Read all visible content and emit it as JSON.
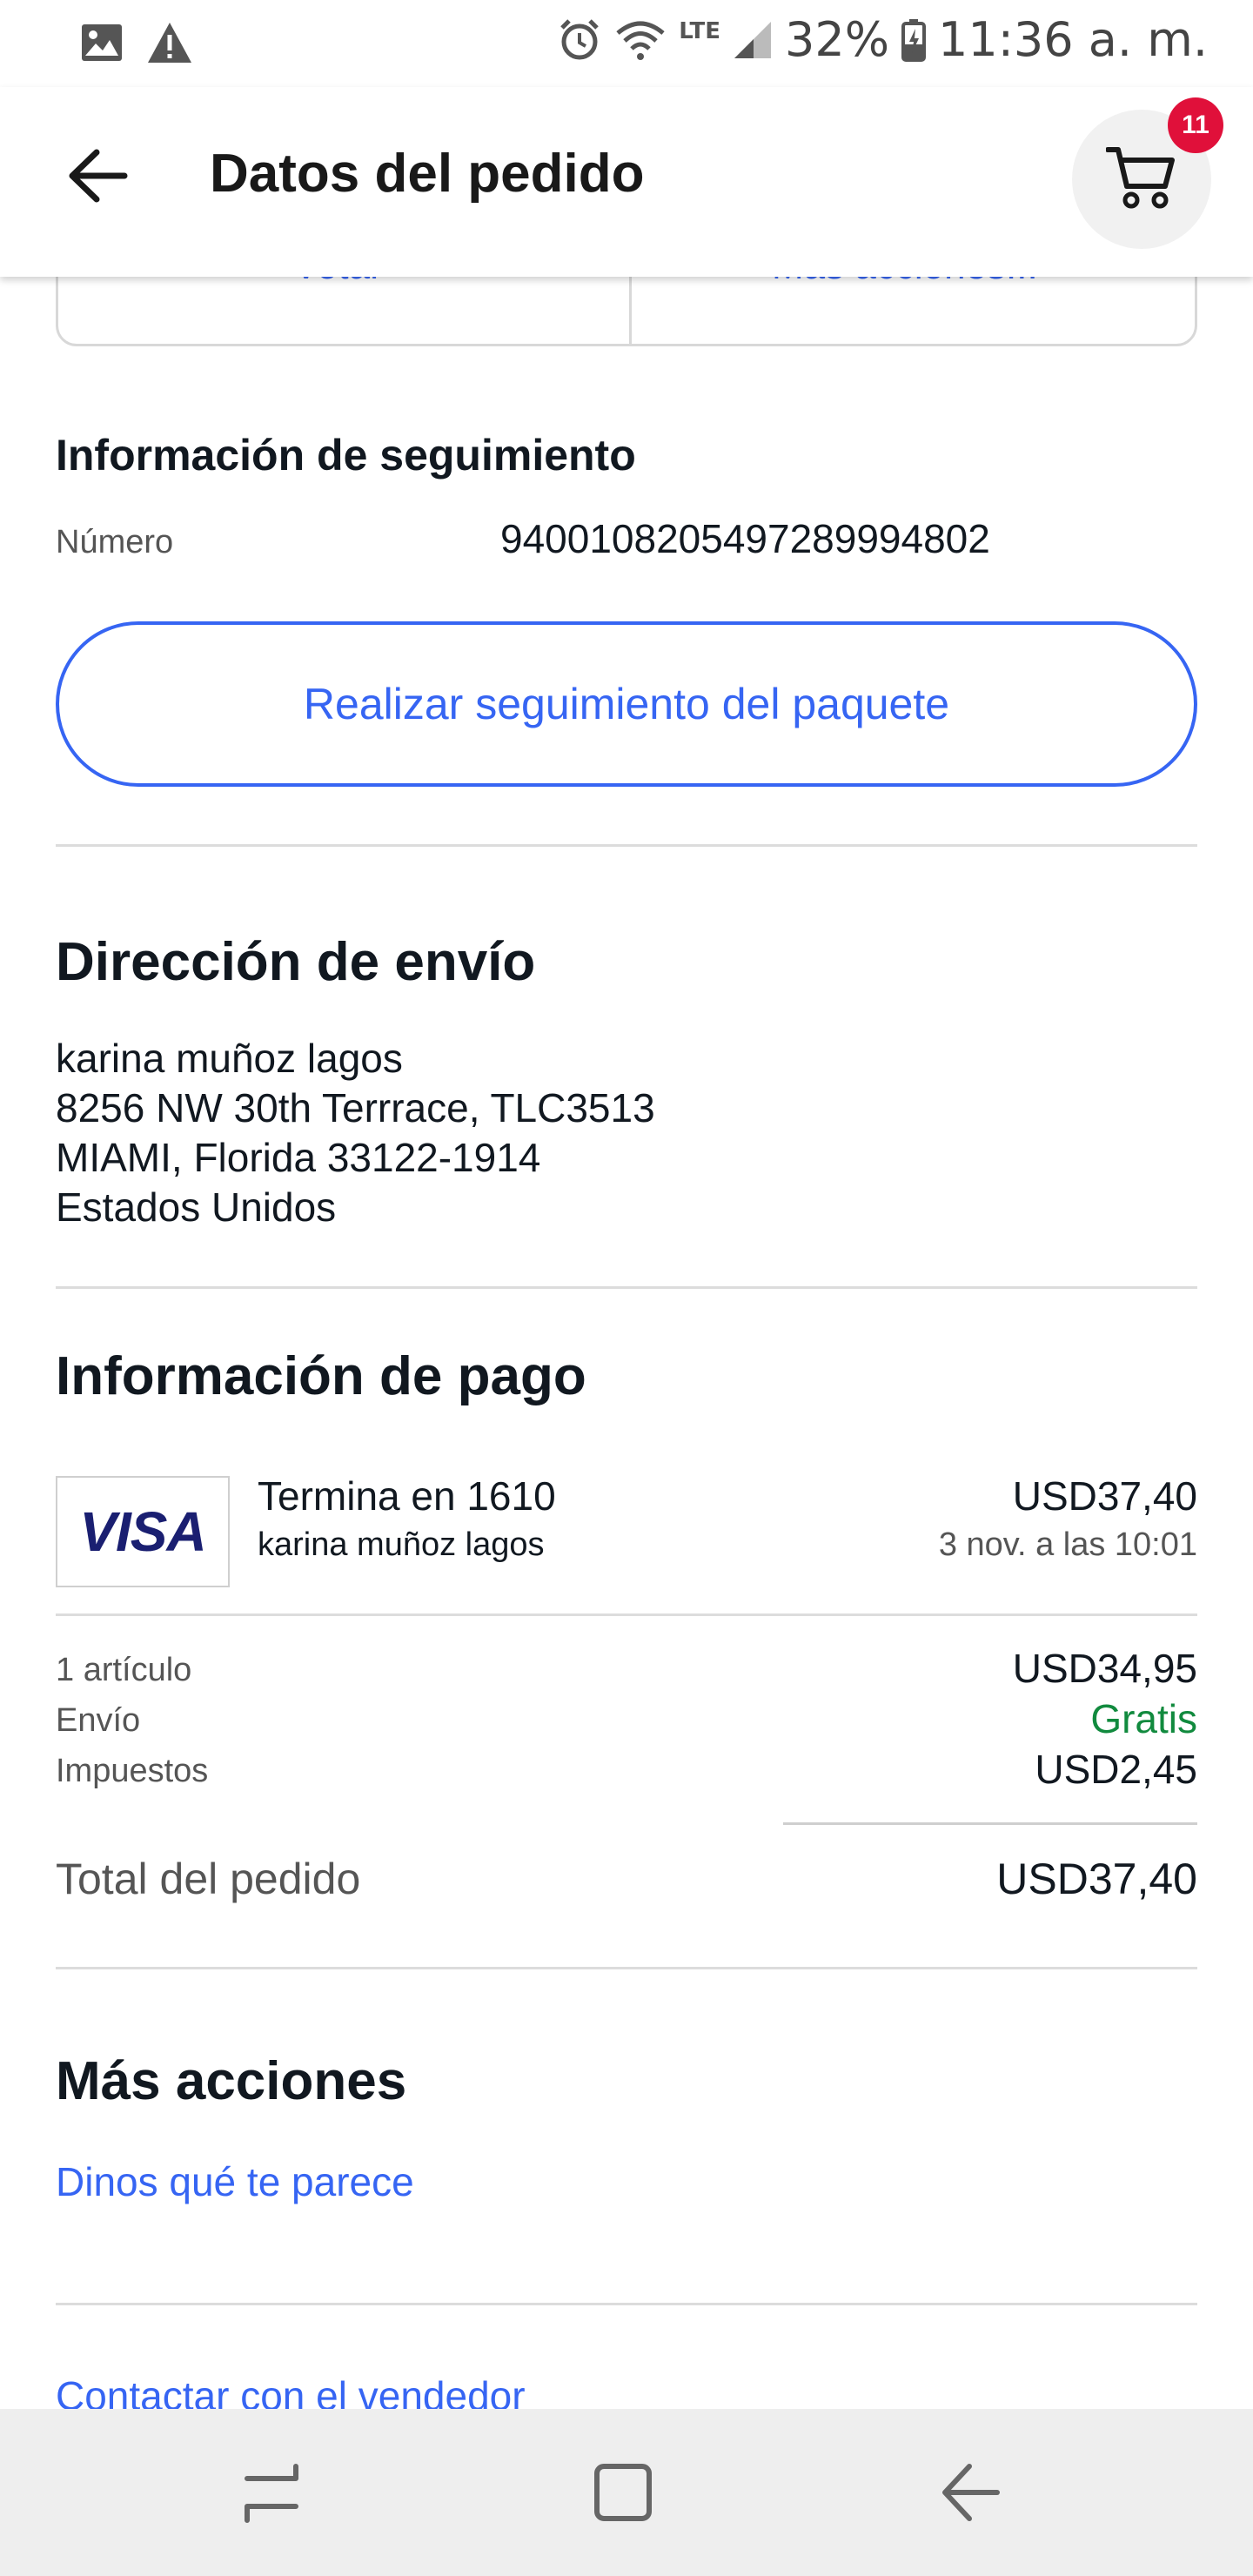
{
  "status_bar": {
    "left_icons": [
      "image-icon",
      "warning-icon"
    ],
    "network": "LTE",
    "battery": "32%",
    "time": "11:36 a. m."
  },
  "app_bar": {
    "title": "Datos del pedido",
    "cart_badge": "11"
  },
  "previous_card": {
    "left_button": "Votar",
    "right_button": "Más acciones..."
  },
  "tracking": {
    "title": "Información de seguimiento",
    "number_label": "Número",
    "number_value": "9400108205497289994802",
    "track_button": "Realizar seguimiento del paquete"
  },
  "shipping": {
    "title": "Dirección de envío",
    "lines": [
      "karina muñoz lagos",
      "8256 NW 30th Terrrace, TLC3513",
      "MIAMI, Florida 33122-1914",
      "Estados Unidos"
    ]
  },
  "payment": {
    "title": "Información de pago",
    "card_brand": "VISA",
    "card_label": "Termina en 1610",
    "card_holder": "karina muñoz lagos",
    "amount": "USD37,40",
    "date": "3 nov. a las 10:01",
    "summary": [
      {
        "label": "1 artículo",
        "value": "USD34,95"
      },
      {
        "label": "Envío",
        "value": "Gratis"
      },
      {
        "label": "Impuestos",
        "value": "USD2,45"
      }
    ],
    "total_label": "Total del pedido",
    "total_value": "USD37,40",
    "free_color": "#118a3e"
  },
  "more_actions": {
    "title": "Más acciones",
    "links": [
      "Dinos qué te parece",
      "Contactar con el vendedor"
    ]
  },
  "colors": {
    "link_blue": "#3665f3",
    "badge_red": "#e0103a"
  }
}
